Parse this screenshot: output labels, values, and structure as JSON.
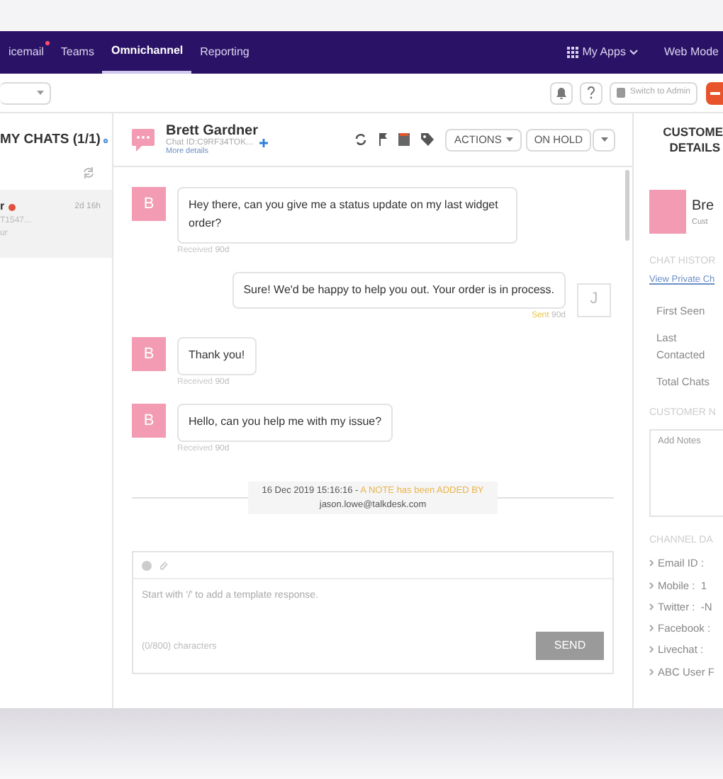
{
  "nav": {
    "tabs": [
      {
        "label": "icemail",
        "selected": false,
        "alert": true
      },
      {
        "label": "Teams",
        "selected": false,
        "alert": false
      },
      {
        "label": "Omnichannel",
        "selected": true,
        "alert": false
      },
      {
        "label": "Reporting",
        "selected": false,
        "alert": false
      }
    ],
    "right": [
      "My Apps",
      "Web Mode"
    ]
  },
  "toolbar": {
    "switch_label": "Switch to Admin"
  },
  "my_chats": {
    "title": "MY CHATS (1/1)",
    "items": [
      {
        "name": "r",
        "time": "2d 16h",
        "id": "T1547...",
        "preview": "ur",
        "online": true,
        "selected": true
      }
    ]
  },
  "chat": {
    "name": "Brett Gardner",
    "chat_id": "Chat ID:C9RF34TOK...",
    "more": "More details",
    "actions": "ACTIONS",
    "status": "ON HOLD",
    "messages": [
      {
        "kind": "received",
        "avatar": "B",
        "text": "Hey there, can you give me a status update on my last widget order?",
        "meta_label": "Received",
        "meta_time": "90d"
      },
      {
        "kind": "sent",
        "avatar": "J",
        "text": "Sure! We'd be happy to help you out. Your order is in process.",
        "meta_label": "Sent",
        "meta_time": "90d"
      },
      {
        "kind": "received",
        "avatar": "B",
        "text": "Thank you!",
        "meta_label": "Received",
        "meta_time": "90d"
      },
      {
        "kind": "received",
        "avatar": "B",
        "text": "Hello, can you help me with my issue?",
        "meta_label": "Received",
        "meta_time": "90d"
      }
    ],
    "note": {
      "time": "16 Dec 2019 15:16:16 -",
      "label": "A NOTE has been ADDED BY",
      "author": "jason.lowe@talkdesk.com"
    },
    "composer": {
      "placeholder": "Start with '/' to add a template response.",
      "count": "(0/800) characters",
      "send": "SEND",
      "send_disabled": true
    }
  },
  "customer": {
    "title_1": "CUSTOME",
    "title_2": "DETAILS",
    "name": "Bre",
    "sub": "Cust",
    "history": "CHAT HISTOR",
    "private_link": "View Private Ch",
    "fields": [
      "First Seen",
      "Last Contacted",
      "Total Chats"
    ],
    "notes_title": "CUSTOMER N",
    "notes_placeholder": "Add Notes",
    "channel_title": "CHANNEL DA",
    "channels": [
      "Email ID :",
      "Mobile :  1",
      "Twitter :  -N",
      "Facebook :",
      "Livechat :",
      "ABC User F"
    ]
  }
}
